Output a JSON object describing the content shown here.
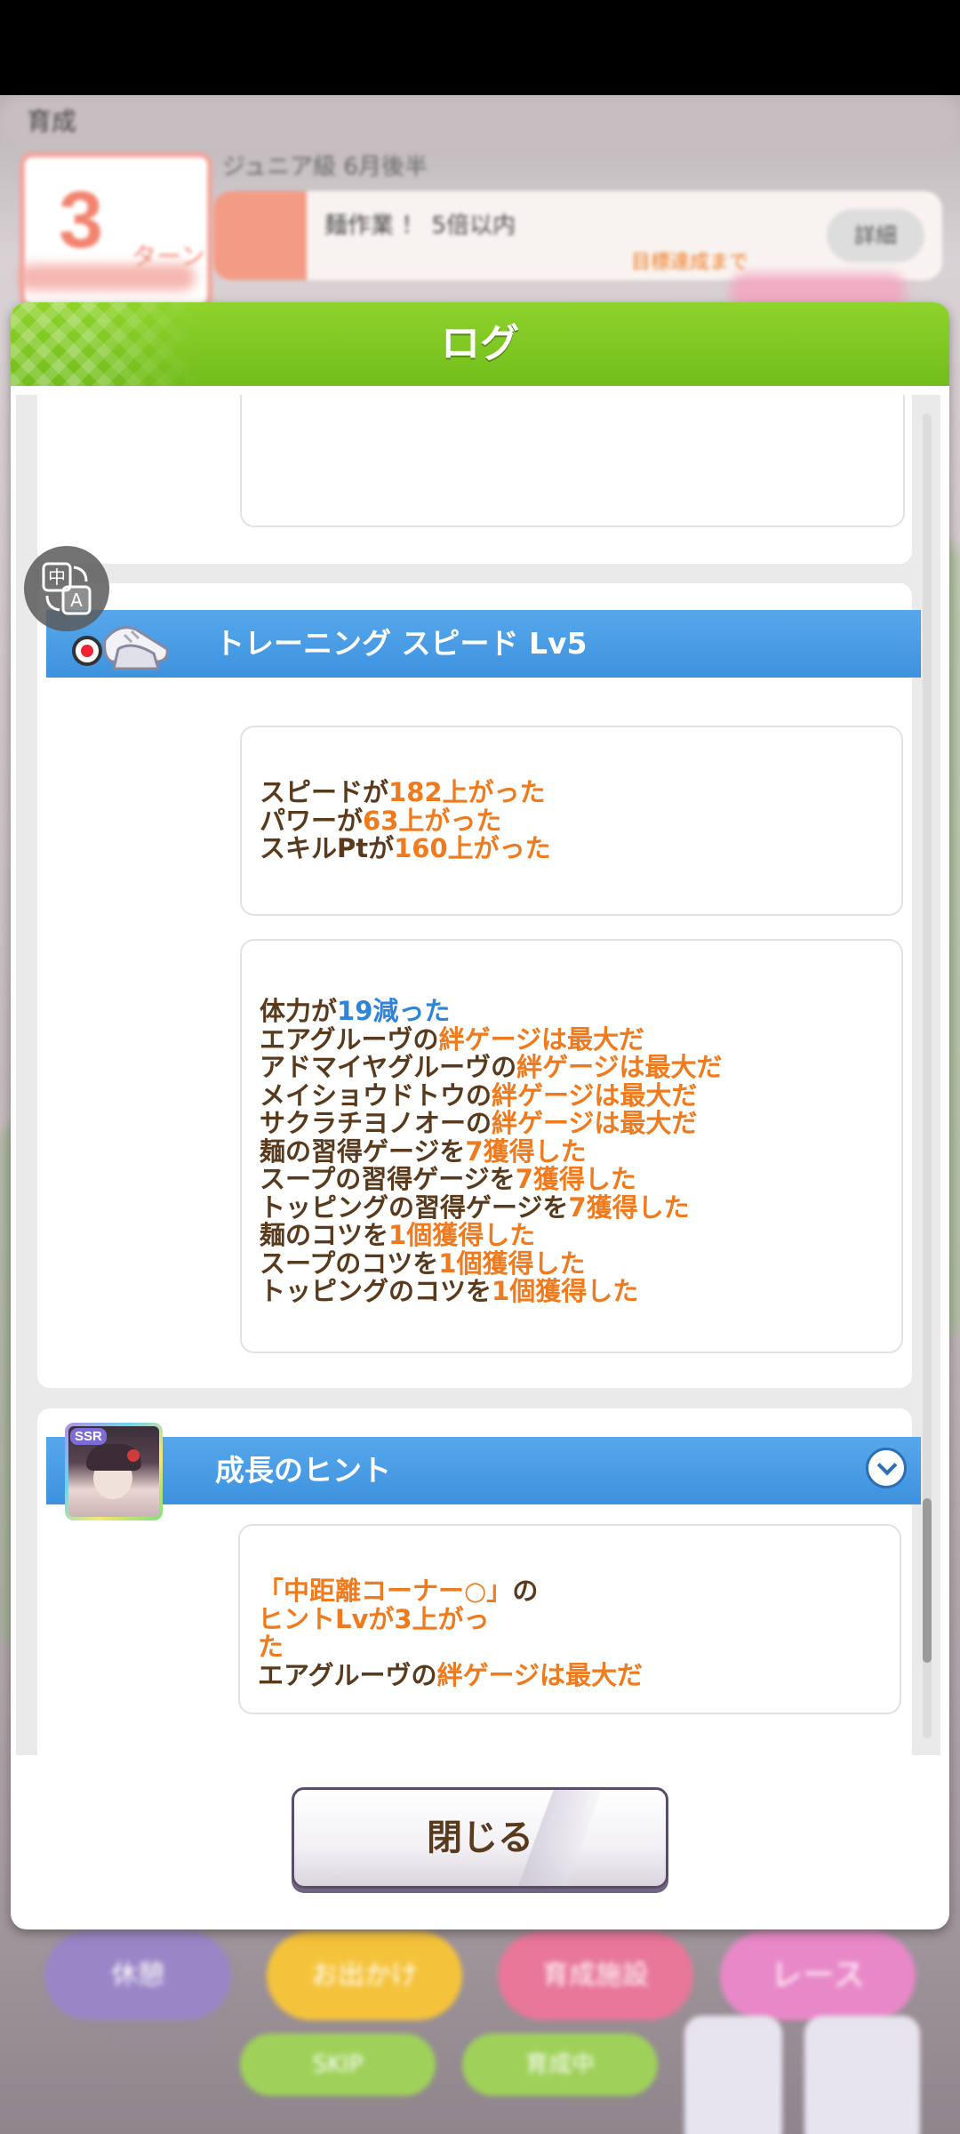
{
  "background": {
    "turn_label": "育成",
    "turn_number": "3",
    "turn_unit": "ターン",
    "subtitle": "ジュニア級 6月後半",
    "notice_text": "麺作業 ！ 5倍以内",
    "notice_sub": "目標達成まで",
    "notice_button": "詳細",
    "bottom_buttons": [
      "休憩",
      "お出かけ",
      "育成施設",
      "レース"
    ],
    "skip_label": "SKIP",
    "auto_label": "育成中"
  },
  "dialog": {
    "title": "ログ"
  },
  "entries": [
    {
      "header": "トレーニング スピード Lv5",
      "icon": "shoes-icon",
      "boxes": [
        [
          [
            "スピードが",
            "182上がった"
          ],
          [
            "パワーが",
            "63上がった"
          ],
          [
            "スキルPtが",
            "160上がった"
          ]
        ],
        [
          [
            "体力が",
            "19減った"
          ],
          [
            "エアグルーヴの",
            "絆ゲージは最大だ"
          ],
          [
            "アドマイヤグルーヴの",
            "絆ゲージは最大だ"
          ],
          [
            "メイショウドトウの",
            "絆ゲージは最大だ"
          ],
          [
            "サクラチヨノオーの",
            "絆ゲージは最大だ"
          ],
          [
            "麺の習得ゲージを",
            "7獲得した"
          ],
          [
            "スープの習得ゲージを",
            "7獲得した"
          ],
          [
            "トッピングの習得ゲージを",
            "7獲得した"
          ],
          [
            "麺のコツを",
            "1個獲得した"
          ],
          [
            "スープのコツを",
            "1個獲得した"
          ],
          [
            "トッピングのコツを",
            "1個獲得した"
          ]
        ]
      ]
    },
    {
      "header": "成長のヒント",
      "icon": "support-card-portrait",
      "portrait_badge": "SSR",
      "boxes": [
        [
          [
            "「中距離コーナー○」",
            "の"
          ],
          [
            "ヒントLvが3上がっ",
            ""
          ],
          [
            "た",
            ""
          ],
          [
            "エアグルーヴの",
            "絆ゲージは最大だ"
          ]
        ]
      ]
    }
  ],
  "close_button": {
    "label": "閉じる"
  },
  "colors": {
    "header_green": "#7cc41f",
    "entry_blue": "#4a9de5",
    "text_brown": "#5a3a1c",
    "highlight_orange": "#f07a1e",
    "highlight_blue": "#2e84d8"
  }
}
